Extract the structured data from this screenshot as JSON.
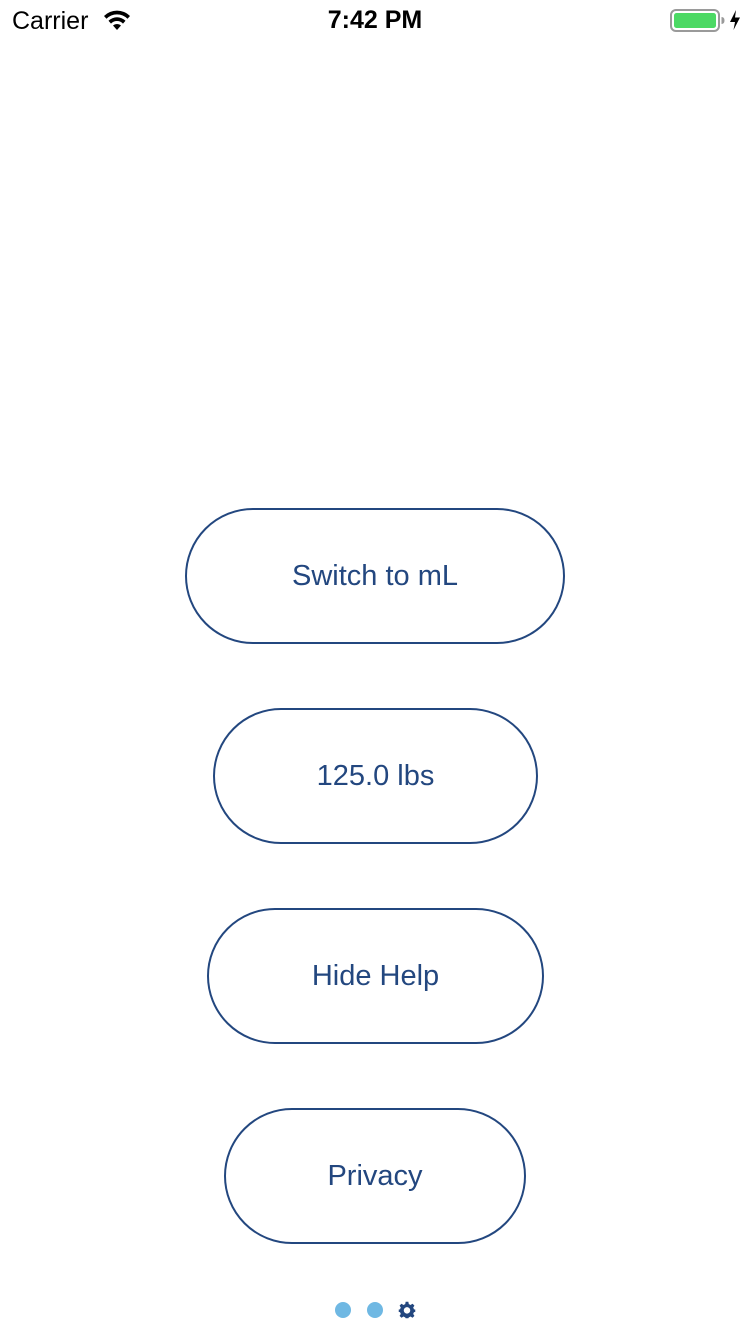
{
  "status_bar": {
    "carrier": "Carrier",
    "time": "7:42 PM",
    "battery_color": "#4cd964",
    "icons": [
      "wifi-icon",
      "battery-icon",
      "charging-icon"
    ]
  },
  "settings": {
    "units_button_label": "Switch to mL",
    "weight_button_label": "125.0 lbs",
    "help_button_label": "Hide Help",
    "privacy_button_label": "Privacy",
    "accent_color": "#23477f"
  },
  "page_indicator": {
    "page_count": 3,
    "current_page": 3,
    "dot_color": "#6fb8e3",
    "current_page_icon": "gear-icon"
  }
}
